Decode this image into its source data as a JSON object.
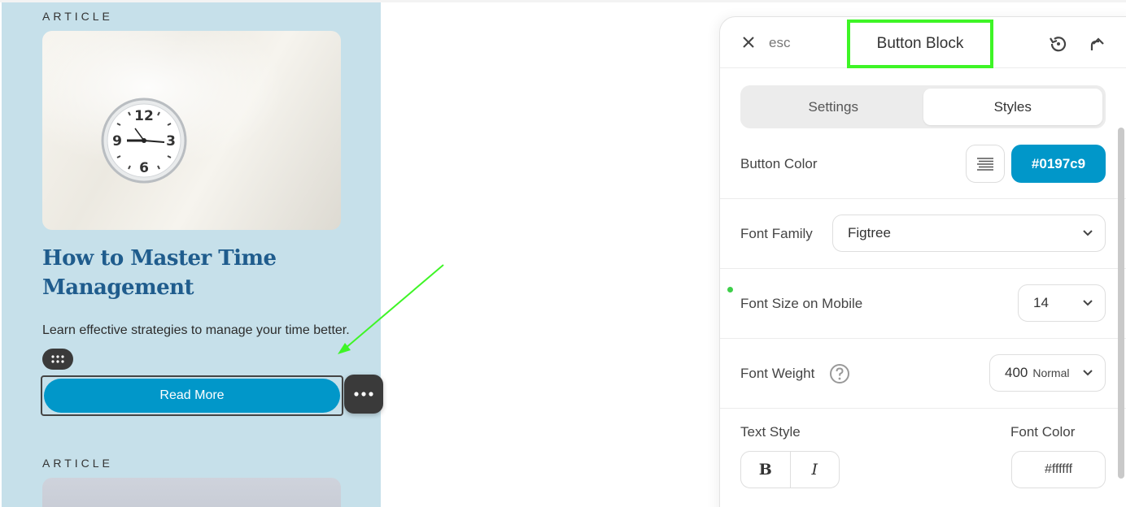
{
  "preview": {
    "eyebrow_1": "ARTICLE",
    "eyebrow_2": "ARTICLE",
    "card_title": "How to Master Time Management",
    "card_description": "Learn effective strategies to manage your time better.",
    "button_label": "Read More"
  },
  "panel": {
    "esc_label": "esc",
    "title": "Button Block",
    "tabs": [
      {
        "label": "Settings",
        "active": false
      },
      {
        "label": "Styles",
        "active": true
      }
    ],
    "button_color": {
      "label": "Button Color",
      "value": "#0197c9"
    },
    "font_family": {
      "label": "Font Family",
      "value": "Figtree"
    },
    "font_size_mobile": {
      "label": "Font Size on Mobile",
      "value": "14"
    },
    "font_weight": {
      "label": "Font Weight",
      "value": "400",
      "value_suffix": "Normal"
    },
    "text_style": {
      "label": "Text Style",
      "bold": "B",
      "italic": "I"
    },
    "font_color": {
      "label": "Font Color",
      "value": "#ffffff"
    }
  },
  "colors": {
    "accent": "#0197c9",
    "preview_bg": "#c6e0ea",
    "title_color": "#1f5c8d",
    "highlight": "#3ef526"
  },
  "icons": [
    "close-icon",
    "history-icon",
    "share-icon",
    "drag-handle-icon",
    "more-icon",
    "help-icon",
    "chevron-down-icon",
    "gradient-swatch-icon",
    "clock-image"
  ]
}
